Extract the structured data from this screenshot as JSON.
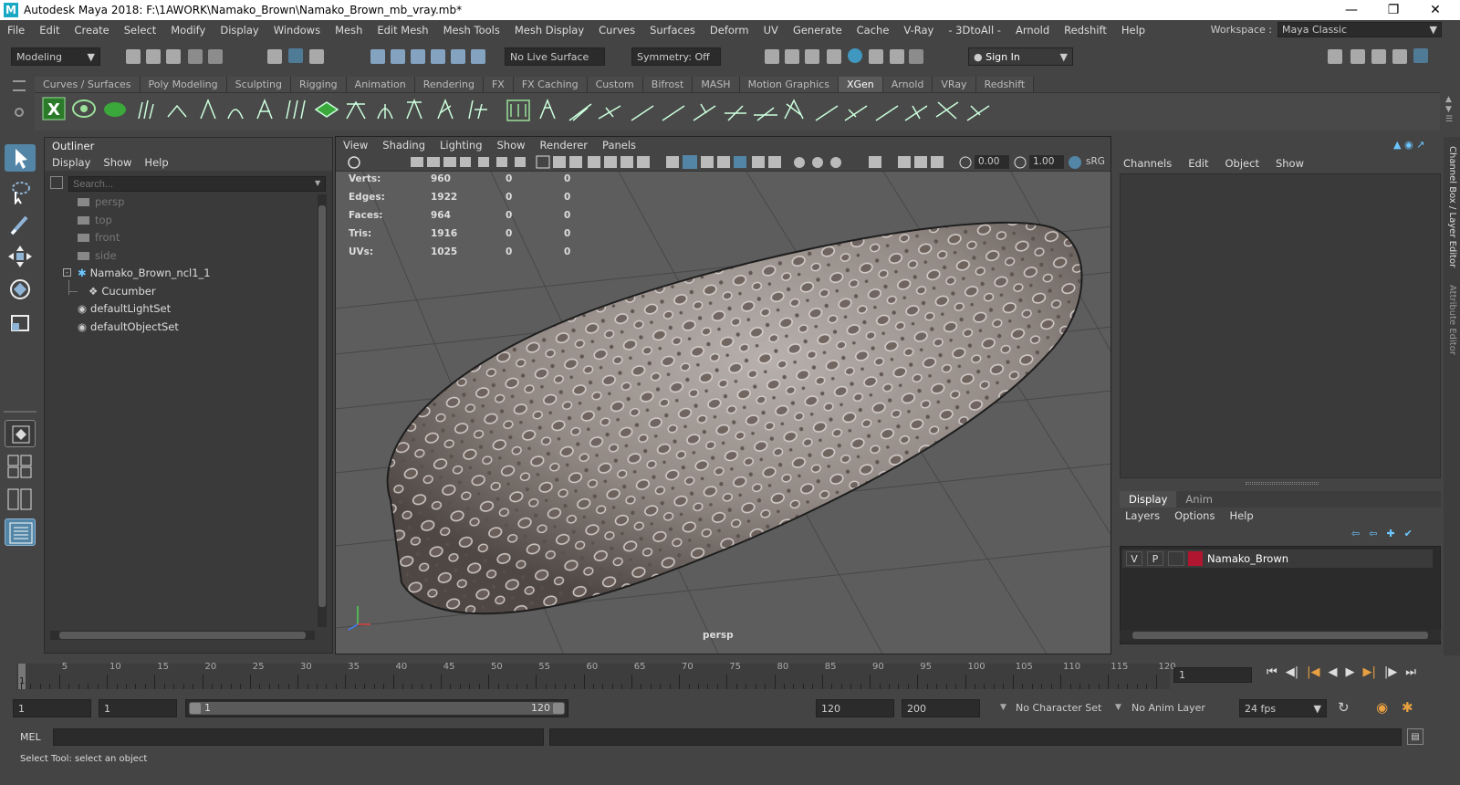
{
  "window": {
    "title": "Autodesk Maya 2018: F:\\1AWORK\\Namako_Brown\\Namako_Brown_mb_vray.mb*",
    "logo_letter": "M"
  },
  "menubar": [
    "File",
    "Edit",
    "Create",
    "Select",
    "Modify",
    "Display",
    "Windows",
    "Mesh",
    "Edit Mesh",
    "Mesh Tools",
    "Mesh Display",
    "Curves",
    "Surfaces",
    "Deform",
    "UV",
    "Generate",
    "Cache",
    "V-Ray",
    "- 3DtoAll -",
    "Arnold",
    "Redshift",
    "Help"
  ],
  "workspace": {
    "label": "Workspace :",
    "value": "Maya Classic"
  },
  "status": {
    "mode": "Modeling",
    "live_surface": "No Live Surface",
    "symmetry": "Symmetry: Off",
    "sign_in": "Sign In"
  },
  "shelf_tabs": [
    "Curves / Surfaces",
    "Poly Modeling",
    "Sculpting",
    "Rigging",
    "Animation",
    "Rendering",
    "FX",
    "FX Caching",
    "Custom",
    "Bifrost",
    "MASH",
    "Motion Graphics",
    "XGen",
    "Arnold",
    "VRay",
    "Redshift"
  ],
  "shelf_active": "XGen",
  "outliner": {
    "title": "Outliner",
    "menus": [
      "Display",
      "Show",
      "Help"
    ],
    "search_placeholder": "Search...",
    "items": [
      {
        "label": "persp",
        "type": "camera",
        "indent": 0,
        "dim": true
      },
      {
        "label": "top",
        "type": "camera",
        "indent": 0,
        "dim": true
      },
      {
        "label": "front",
        "type": "camera",
        "indent": 0,
        "dim": true
      },
      {
        "label": "side",
        "type": "camera",
        "indent": 0,
        "dim": true
      },
      {
        "label": "Namako_Brown_ncl1_1",
        "type": "group",
        "indent": 0,
        "dim": false
      },
      {
        "label": "Cucumber",
        "type": "mesh",
        "indent": 1,
        "dim": false
      },
      {
        "label": "defaultLightSet",
        "type": "set",
        "indent": 0,
        "dim": false
      },
      {
        "label": "defaultObjectSet",
        "type": "set",
        "indent": 0,
        "dim": false
      }
    ]
  },
  "viewport": {
    "menus": [
      "View",
      "Shading",
      "Lighting",
      "Show",
      "Renderer",
      "Panels"
    ],
    "field_a": "0.00",
    "field_b": "1.00",
    "colorspace": "sRG",
    "camera_label": "persp",
    "hud": [
      {
        "label": "Verts:",
        "v1": "960",
        "v2": "0",
        "v3": "0"
      },
      {
        "label": "Edges:",
        "v1": "1922",
        "v2": "0",
        "v3": "0"
      },
      {
        "label": "Faces:",
        "v1": "964",
        "v2": "0",
        "v3": "0"
      },
      {
        "label": "Tris:",
        "v1": "1916",
        "v2": "0",
        "v3": "0"
      },
      {
        "label": "UVs:",
        "v1": "1025",
        "v2": "0",
        "v3": "0"
      }
    ]
  },
  "channelbox": {
    "menus": [
      "Channels",
      "Edit",
      "Object",
      "Show"
    ],
    "side_tab_1": "Channel Box / Layer Editor",
    "side_tab_2": "Attribute Editor"
  },
  "layers": {
    "tabs": [
      "Display",
      "Anim"
    ],
    "menus": [
      "Layers",
      "Options",
      "Help"
    ],
    "layer": {
      "v": "V",
      "p": "P",
      "name": "Namako_Brown",
      "color": "#b0162f"
    }
  },
  "timeline": {
    "ticks": [
      "5",
      "10",
      "15",
      "20",
      "25",
      "30",
      "35",
      "40",
      "45",
      "50",
      "55",
      "60",
      "65",
      "70",
      "75",
      "80",
      "85",
      "90",
      "95",
      "100",
      "105",
      "110",
      "115",
      "120"
    ],
    "start_mark": "1",
    "current_frame": "1"
  },
  "range": {
    "start": "1",
    "start2": "1",
    "slider_start": "1",
    "slider_end": "120",
    "end": "120",
    "end2": "200",
    "character_set": "No Character Set",
    "anim_layer": "No Anim Layer",
    "fps": "24 fps"
  },
  "cmdline": {
    "label": "MEL"
  },
  "helpline": {
    "text": "Select Tool: select an object"
  }
}
